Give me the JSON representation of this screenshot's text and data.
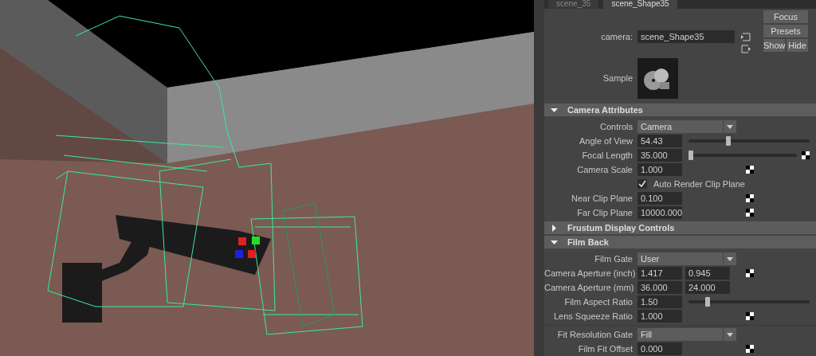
{
  "tabs": [
    {
      "label": "scene_35",
      "selected": false
    },
    {
      "label": "scene_Shape35",
      "selected": true
    }
  ],
  "camera": {
    "label": "camera:",
    "value": "scene_Shape35"
  },
  "buttons": [
    "Focus",
    "Presets",
    "Show",
    "Hide"
  ],
  "sample": {
    "label": "Sample"
  },
  "sections": [
    {
      "title": "Camera Attributes",
      "expanded": true,
      "rows": [
        {
          "kind": "dropdown",
          "label": "Controls",
          "value": "Camera"
        },
        {
          "kind": "slider",
          "label": "Angle of View",
          "value": "54.43",
          "level": 0.33,
          "map_button": false
        },
        {
          "kind": "slider",
          "label": "Focal Length",
          "value": "35.000",
          "level": 0.02,
          "map_button": true
        },
        {
          "kind": "field",
          "label": "Camera Scale",
          "value": "1.000",
          "map_button": true
        },
        {
          "kind": "checkbox",
          "label": "Auto Render Clip Plane",
          "checked": true
        },
        {
          "kind": "field",
          "label": "Near Clip Plane",
          "value": "0.100",
          "map_button": true
        },
        {
          "kind": "field",
          "label": "Far Clip Plane",
          "value": "10000.000",
          "map_button": true
        }
      ]
    },
    {
      "title": "Frustum Display Controls",
      "expanded": false
    },
    {
      "title": "Film Back",
      "expanded": true,
      "rows": [
        {
          "kind": "dropdown",
          "label": "Film Gate",
          "value": "User"
        },
        {
          "kind": "pair",
          "label": "Camera Aperture (inch)",
          "values": [
            "1.417",
            "0.945"
          ],
          "map_button": true
        },
        {
          "kind": "pair",
          "label": "Camera Aperture (mm)",
          "values": [
            "36.000",
            "24.000"
          ],
          "map_button": false
        },
        {
          "kind": "slider",
          "label": "Film Aspect Ratio",
          "value": "1.50",
          "level": 0.16,
          "map_button": false
        },
        {
          "kind": "field",
          "label": "Lens Squeeze Ratio",
          "value": "1.000",
          "map_button": true
        },
        {
          "kind": "separator"
        },
        {
          "kind": "dropdown",
          "label": "Fit Resolution Gate",
          "value": "Fill"
        },
        {
          "kind": "field",
          "label": "Film Fit Offset",
          "value": "0.000",
          "map_button": true
        }
      ]
    }
  ]
}
